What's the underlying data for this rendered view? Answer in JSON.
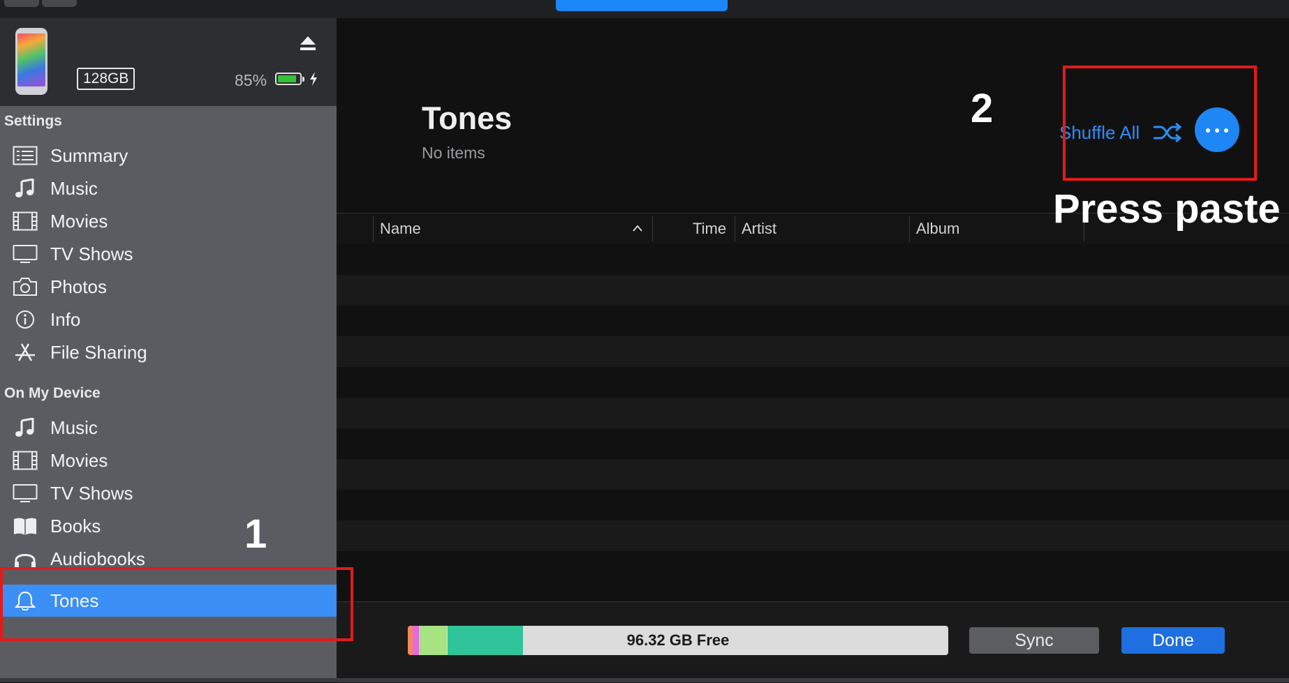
{
  "device": {
    "storage_label": "128GB",
    "battery_percent": "85%",
    "battery_level": 0.85
  },
  "sidebar": {
    "settings_heading": "Settings",
    "settings_items": [
      {
        "label": "Summary",
        "icon": "summary-list-icon"
      },
      {
        "label": "Music",
        "icon": "music-note-icon"
      },
      {
        "label": "Movies",
        "icon": "film-strip-icon"
      },
      {
        "label": "TV Shows",
        "icon": "tv-icon"
      },
      {
        "label": "Photos",
        "icon": "camera-icon"
      },
      {
        "label": "Info",
        "icon": "info-icon"
      },
      {
        "label": "File Sharing",
        "icon": "app-store-icon"
      }
    ],
    "device_heading": "On My Device",
    "device_items": [
      {
        "label": "Music",
        "icon": "music-note-icon"
      },
      {
        "label": "Movies",
        "icon": "film-strip-icon"
      },
      {
        "label": "TV Shows",
        "icon": "tv-icon"
      },
      {
        "label": "Books",
        "icon": "book-icon"
      },
      {
        "label": "Audiobooks",
        "icon": "headphones-icon"
      },
      {
        "label": "Tones",
        "icon": "bell-icon",
        "selected": true
      }
    ]
  },
  "main": {
    "title": "Tones",
    "subtitle": "No items",
    "shuffle_label": "Shuffle All",
    "columns": [
      "Name",
      "Time",
      "Artist",
      "Album"
    ]
  },
  "footer": {
    "free_space": "96.32 GB Free",
    "sync_label": "Sync",
    "done_label": "Done",
    "storage_segments": [
      {
        "color": "#f5875a",
        "fraction": 0.009
      },
      {
        "color": "#e46ae0",
        "fraction": 0.012
      },
      {
        "color": "#a8e383",
        "fraction": 0.052
      },
      {
        "color": "#2fc49a",
        "fraction": 0.14
      }
    ]
  },
  "annotations": {
    "step1": "1",
    "step2": "2",
    "instruction": "Press paste"
  },
  "colors": {
    "accent": "#2d8ef6",
    "selected_bg": "#3b8ff5",
    "annotation_red": "#e21b1b"
  }
}
